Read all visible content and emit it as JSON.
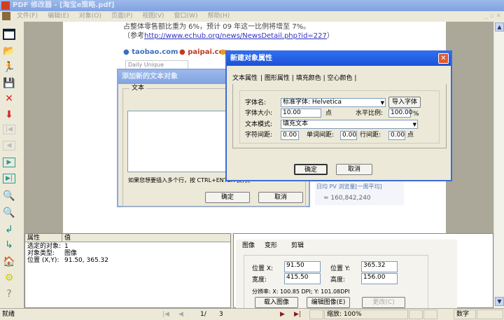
{
  "window": {
    "title": "PDF 修改器 - [淘宝e策略.pdf]"
  },
  "menu": [
    "文件(F)",
    "编辑(E)",
    "对象(O)",
    "页面(P)",
    "视图(V)",
    "窗口(W)",
    "帮助(H)"
  ],
  "page": {
    "line1": "占整体零售额比重为 6%，预计 09 年这一比例将增至 7%。",
    "line2_prefix": "（参考",
    "link": "http://www.echub.org/news/NewsDetail.php?id=227",
    "line2_suffix": "）",
    "logo1": "taobao.com",
    "logo2": "paipai.com",
    "table_header": "Daily Unique Visitors",
    "pv_label": "日均 PV 浏览量[一周平均]",
    "pv_value": "≈ 160,842,240"
  },
  "text_dialog": {
    "title": "添加新的文本对象",
    "group": "文本",
    "value": "",
    "hint": "如果您想要插入多个行，按 CTRL+ENTER 换行。",
    "ok": "确定",
    "cancel": "取消"
  },
  "prop_dialog": {
    "title": "新建对象属性",
    "tabs": [
      "文本属性",
      "图形属性",
      "填充颜色",
      "空心颜色"
    ],
    "font_name_label": "字体名:",
    "font_name": "标准字体: Helvetica",
    "import_font": "导入字体",
    "font_size_label": "字体大小:",
    "font_size": "10.00",
    "unit_pt": "点",
    "hscale_label": "水平比例:",
    "hscale": "100.00",
    "unit_pct": "%",
    "text_mode_label": "文本模式:",
    "text_mode": "填充文本",
    "char_spacing_label": "字符间距:",
    "char_spacing": "0.00",
    "word_spacing_label": "单词间距:",
    "word_spacing": "0.00",
    "line_spacing_label": "行间距:",
    "line_spacing": "0.00",
    "unit_pt2": "点",
    "ok": "确定",
    "cancel": "取消"
  },
  "props_panel": {
    "col_attr": "属性",
    "col_value": "值",
    "rows": [
      {
        "k": "选定的对象:",
        "v": "1"
      },
      {
        "k": "对象类型:",
        "v": "图像"
      },
      {
        "k": "位置 (X,Y):",
        "v": "91.50, 365.32"
      }
    ]
  },
  "image_panel": {
    "tabs": [
      "图像",
      "变形",
      "剪辑"
    ],
    "pos_x_label": "位置 X:",
    "pos_x": "91.50",
    "pos_y_label": "位置 Y:",
    "pos_y": "365.32",
    "width_label": "宽度:",
    "width": "415.50",
    "height_label": "高度:",
    "height": "156.00",
    "resolution": "分辨率: X: 100.85 DPI;  Y: 101.08DPI",
    "load_image": "载入图像",
    "edit_image": "编辑图像(E)",
    "change": "更改(C)"
  },
  "status": {
    "ready": "就绪",
    "page_current": "1/",
    "page_total": "3",
    "zoom": "缩放:  100%",
    "num": "数字"
  }
}
